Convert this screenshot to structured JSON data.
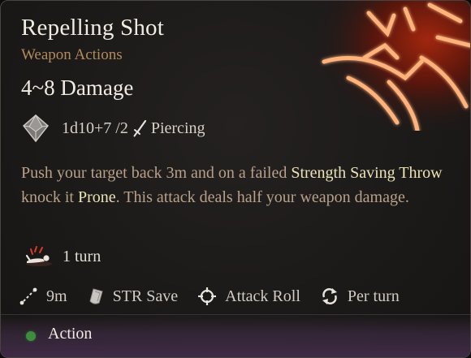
{
  "spell": {
    "title": "Repelling Shot",
    "category": "Weapon Actions",
    "damage": "4~8 Damage",
    "dice_formula": "1d10+7 /2",
    "damage_type": "Piercing",
    "description": {
      "part1": "Push your target back 3m and on a failed ",
      "kw1": "Strength Saving Throw",
      "part2": " knock it ",
      "kw2": "Prone",
      "part3": ". This attack deals half your weapon damage."
    },
    "condition_duration": "1 turn",
    "stats": {
      "range": "9m",
      "save": "STR Save",
      "attack": "Attack Roll",
      "recharge": "Per turn"
    },
    "resource": "Action"
  },
  "icons": [
    "d10-die-icon",
    "sword-icon",
    "prone-icon",
    "range-icon",
    "save-shield-icon",
    "crosshair-icon",
    "recharge-icon",
    "action-dot-icon"
  ],
  "colors": {
    "keyword": "#ece3b7",
    "subtitle": "#b38a5e",
    "action_dot": "#3e8d3f",
    "glow": "#ff6a2a"
  }
}
